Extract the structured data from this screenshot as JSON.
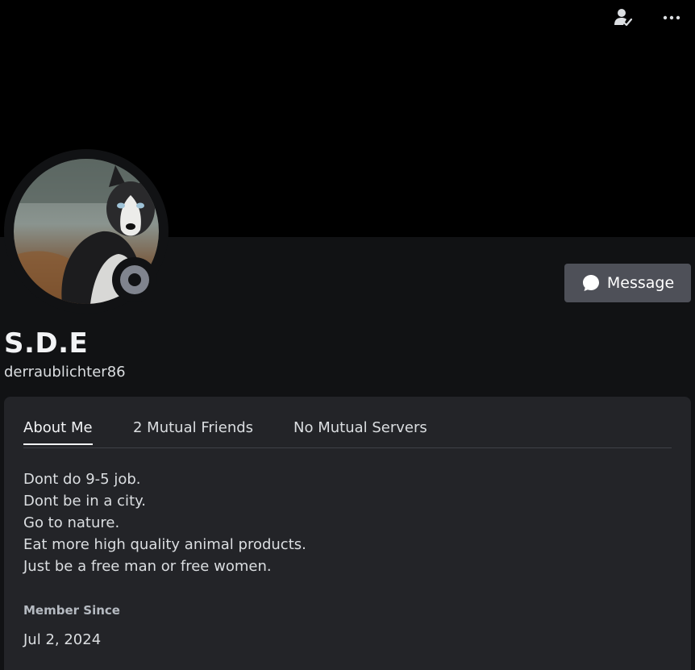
{
  "profile": {
    "display_name": "S.D.E",
    "username": "derraublichter86",
    "status": "offline"
  },
  "header": {
    "icons": [
      "add-friend-icon",
      "more-options-icon"
    ]
  },
  "actions": {
    "message_label": "Message"
  },
  "tabs": [
    {
      "label": "About Me",
      "active": true
    },
    {
      "label": "2 Mutual Friends",
      "active": false
    },
    {
      "label": "No Mutual Servers",
      "active": false
    }
  ],
  "about": {
    "bio_lines": [
      "Dont do 9-5 job.",
      "Dont be in a city.",
      "Go to nature.",
      "Eat more high quality animal products.",
      "Just be a free man or free women."
    ],
    "member_since_label": "Member Since",
    "member_since_date": "Jul 2, 2024"
  },
  "colors": {
    "background": "#111214",
    "banner": "#000000",
    "card": "#232428",
    "button": "#4e5058",
    "status_offline": "#80848e"
  }
}
